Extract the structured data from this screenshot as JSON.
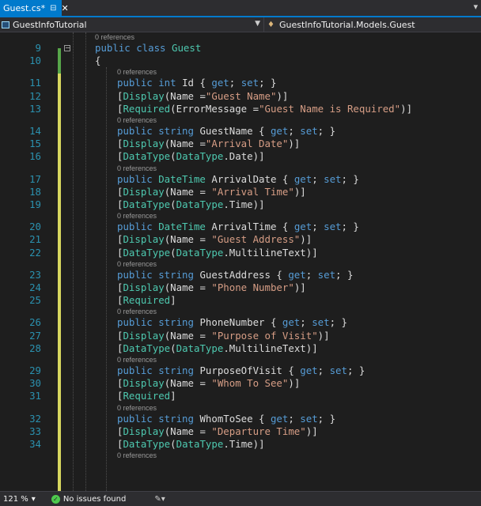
{
  "tab": {
    "title": "Guest.cs*",
    "pin_icon": "pin-icon",
    "close_icon": "close-icon"
  },
  "nav": {
    "project": "GuestInfoTutorial",
    "class": "GuestInfoTutorial.Models.Guest"
  },
  "lens_label": "0 references",
  "lines": [
    {
      "num": "9",
      "tokens": [
        {
          "t": "public class ",
          "c": "kw"
        },
        {
          "t": "Guest",
          "c": "ty"
        }
      ]
    },
    {
      "num": "10",
      "tokens": [
        {
          "t": "{",
          "c": "pu"
        }
      ]
    },
    {
      "num": "11",
      "tokens": [
        {
          "t": "public int ",
          "c": "kw"
        },
        {
          "t": "Id { ",
          "c": "pu"
        },
        {
          "t": "get",
          "c": "kw"
        },
        {
          "t": "; ",
          "c": "pu"
        },
        {
          "t": "set",
          "c": "kw"
        },
        {
          "t": "; }",
          "c": "pu"
        }
      ]
    },
    {
      "num": "12",
      "tokens": [
        {
          "t": "[",
          "c": "pu"
        },
        {
          "t": "Display",
          "c": "ty"
        },
        {
          "t": "(Name =",
          "c": "pu"
        },
        {
          "t": "\"Guest Name\"",
          "c": "st"
        },
        {
          "t": ")]",
          "c": "pu"
        }
      ]
    },
    {
      "num": "13",
      "tokens": [
        {
          "t": "[",
          "c": "pu"
        },
        {
          "t": "Required",
          "c": "ty"
        },
        {
          "t": "(ErrorMessage =",
          "c": "pu"
        },
        {
          "t": "\"Guest Name is Required\"",
          "c": "st"
        },
        {
          "t": ")]",
          "c": "pu"
        }
      ]
    },
    {
      "num": "14",
      "tokens": [
        {
          "t": "public string ",
          "c": "kw"
        },
        {
          "t": "GuestName { ",
          "c": "pu"
        },
        {
          "t": "get",
          "c": "kw"
        },
        {
          "t": "; ",
          "c": "pu"
        },
        {
          "t": "set",
          "c": "kw"
        },
        {
          "t": "; }",
          "c": "pu"
        }
      ]
    },
    {
      "num": "15",
      "tokens": [
        {
          "t": "[",
          "c": "pu"
        },
        {
          "t": "Display",
          "c": "ty"
        },
        {
          "t": "(Name =",
          "c": "pu"
        },
        {
          "t": "\"Arrival Date\"",
          "c": "st"
        },
        {
          "t": ")]",
          "c": "pu"
        }
      ]
    },
    {
      "num": "16",
      "tokens": [
        {
          "t": "[",
          "c": "pu"
        },
        {
          "t": "DataType",
          "c": "ty"
        },
        {
          "t": "(",
          "c": "pu"
        },
        {
          "t": "DataType",
          "c": "ty"
        },
        {
          "t": ".Date)]",
          "c": "pu"
        }
      ]
    },
    {
      "num": "17",
      "tokens": [
        {
          "t": "public ",
          "c": "kw"
        },
        {
          "t": "DateTime",
          "c": "ty"
        },
        {
          "t": " ArrivalDate { ",
          "c": "pu"
        },
        {
          "t": "get",
          "c": "kw"
        },
        {
          "t": "; ",
          "c": "pu"
        },
        {
          "t": "set",
          "c": "kw"
        },
        {
          "t": "; }",
          "c": "pu"
        }
      ]
    },
    {
      "num": "18",
      "tokens": [
        {
          "t": "[",
          "c": "pu"
        },
        {
          "t": "Display",
          "c": "ty"
        },
        {
          "t": "(Name = ",
          "c": "pu"
        },
        {
          "t": "\"Arrival Time\"",
          "c": "st"
        },
        {
          "t": ")]",
          "c": "pu"
        }
      ]
    },
    {
      "num": "19",
      "tokens": [
        {
          "t": "[",
          "c": "pu"
        },
        {
          "t": "DataType",
          "c": "ty"
        },
        {
          "t": "(",
          "c": "pu"
        },
        {
          "t": "DataType",
          "c": "ty"
        },
        {
          "t": ".Time)]",
          "c": "pu"
        }
      ]
    },
    {
      "num": "20",
      "tokens": [
        {
          "t": "public ",
          "c": "kw"
        },
        {
          "t": "DateTime",
          "c": "ty"
        },
        {
          "t": " ArrivalTime { ",
          "c": "pu"
        },
        {
          "t": "get",
          "c": "kw"
        },
        {
          "t": "; ",
          "c": "pu"
        },
        {
          "t": "set",
          "c": "kw"
        },
        {
          "t": "; }",
          "c": "pu"
        }
      ]
    },
    {
      "num": "21",
      "tokens": [
        {
          "t": "[",
          "c": "pu"
        },
        {
          "t": "Display",
          "c": "ty"
        },
        {
          "t": "(Name = ",
          "c": "pu"
        },
        {
          "t": "\"Guest Address\"",
          "c": "st"
        },
        {
          "t": ")]",
          "c": "pu"
        }
      ]
    },
    {
      "num": "22",
      "tokens": [
        {
          "t": "[",
          "c": "pu"
        },
        {
          "t": "DataType",
          "c": "ty"
        },
        {
          "t": "(",
          "c": "pu"
        },
        {
          "t": "DataType",
          "c": "ty"
        },
        {
          "t": ".MultilineText)]",
          "c": "pu"
        }
      ]
    },
    {
      "num": "23",
      "tokens": [
        {
          "t": "public string ",
          "c": "kw"
        },
        {
          "t": "GuestAddress { ",
          "c": "pu"
        },
        {
          "t": "get",
          "c": "kw"
        },
        {
          "t": "; ",
          "c": "pu"
        },
        {
          "t": "set",
          "c": "kw"
        },
        {
          "t": "; }",
          "c": "pu"
        }
      ]
    },
    {
      "num": "24",
      "tokens": [
        {
          "t": "[",
          "c": "pu"
        },
        {
          "t": "Display",
          "c": "ty"
        },
        {
          "t": "(Name = ",
          "c": "pu"
        },
        {
          "t": "\"Phone Number\"",
          "c": "st"
        },
        {
          "t": ")]",
          "c": "pu"
        }
      ]
    },
    {
      "num": "25",
      "tokens": [
        {
          "t": "[",
          "c": "pu"
        },
        {
          "t": "Required",
          "c": "ty"
        },
        {
          "t": "]",
          "c": "pu"
        }
      ]
    },
    {
      "num": "26",
      "tokens": [
        {
          "t": "public string ",
          "c": "kw"
        },
        {
          "t": "PhoneNumber { ",
          "c": "pu"
        },
        {
          "t": "get",
          "c": "kw"
        },
        {
          "t": "; ",
          "c": "pu"
        },
        {
          "t": "set",
          "c": "kw"
        },
        {
          "t": "; }",
          "c": "pu"
        }
      ]
    },
    {
      "num": "27",
      "tokens": [
        {
          "t": "[",
          "c": "pu"
        },
        {
          "t": "Display",
          "c": "ty"
        },
        {
          "t": "(Name = ",
          "c": "pu"
        },
        {
          "t": "\"Purpose of Visit\"",
          "c": "st"
        },
        {
          "t": ")]",
          "c": "pu"
        }
      ]
    },
    {
      "num": "28",
      "tokens": [
        {
          "t": "[",
          "c": "pu"
        },
        {
          "t": "DataType",
          "c": "ty"
        },
        {
          "t": "(",
          "c": "pu"
        },
        {
          "t": "DataType",
          "c": "ty"
        },
        {
          "t": ".MultilineText)]",
          "c": "pu"
        }
      ]
    },
    {
      "num": "29",
      "tokens": [
        {
          "t": "public string ",
          "c": "kw"
        },
        {
          "t": "PurposeOfVisit { ",
          "c": "pu"
        },
        {
          "t": "get",
          "c": "kw"
        },
        {
          "t": "; ",
          "c": "pu"
        },
        {
          "t": "set",
          "c": "kw"
        },
        {
          "t": "; }",
          "c": "pu"
        }
      ]
    },
    {
      "num": "30",
      "tokens": [
        {
          "t": "[",
          "c": "pu"
        },
        {
          "t": "Display",
          "c": "ty"
        },
        {
          "t": "(Name = ",
          "c": "pu"
        },
        {
          "t": "\"Whom To See\"",
          "c": "st"
        },
        {
          "t": ")]",
          "c": "pu"
        }
      ]
    },
    {
      "num": "31",
      "tokens": [
        {
          "t": "[",
          "c": "pu"
        },
        {
          "t": "Required",
          "c": "ty"
        },
        {
          "t": "]",
          "c": "pu"
        }
      ]
    },
    {
      "num": "32",
      "tokens": [
        {
          "t": "public string ",
          "c": "kw"
        },
        {
          "t": "WhomToSee { ",
          "c": "pu"
        },
        {
          "t": "get",
          "c": "kw"
        },
        {
          "t": "; ",
          "c": "pu"
        },
        {
          "t": "set",
          "c": "kw"
        },
        {
          "t": "; }",
          "c": "pu"
        }
      ]
    },
    {
      "num": "33",
      "tokens": [
        {
          "t": "[",
          "c": "pu"
        },
        {
          "t": "Display",
          "c": "ty"
        },
        {
          "t": "(Name = ",
          "c": "pu"
        },
        {
          "t": "\"Departure Time\"",
          "c": "st"
        },
        {
          "t": ")]",
          "c": "pu"
        }
      ]
    },
    {
      "num": "34",
      "tokens": [
        {
          "t": "[",
          "c": "pu"
        },
        {
          "t": "DataType",
          "c": "ty"
        },
        {
          "t": "(",
          "c": "pu"
        },
        {
          "t": "DataType",
          "c": "ty"
        },
        {
          "t": ".Time)]",
          "c": "pu"
        }
      ]
    }
  ],
  "status": {
    "zoom": "121 %",
    "issues": "No issues found"
  },
  "colors": {
    "accent": "#007acc",
    "keyword": "#569cd6",
    "type": "#4ec9b0",
    "string": "#d69d85",
    "line_number": "#2b91af",
    "change_bar": "#d7d75f"
  }
}
